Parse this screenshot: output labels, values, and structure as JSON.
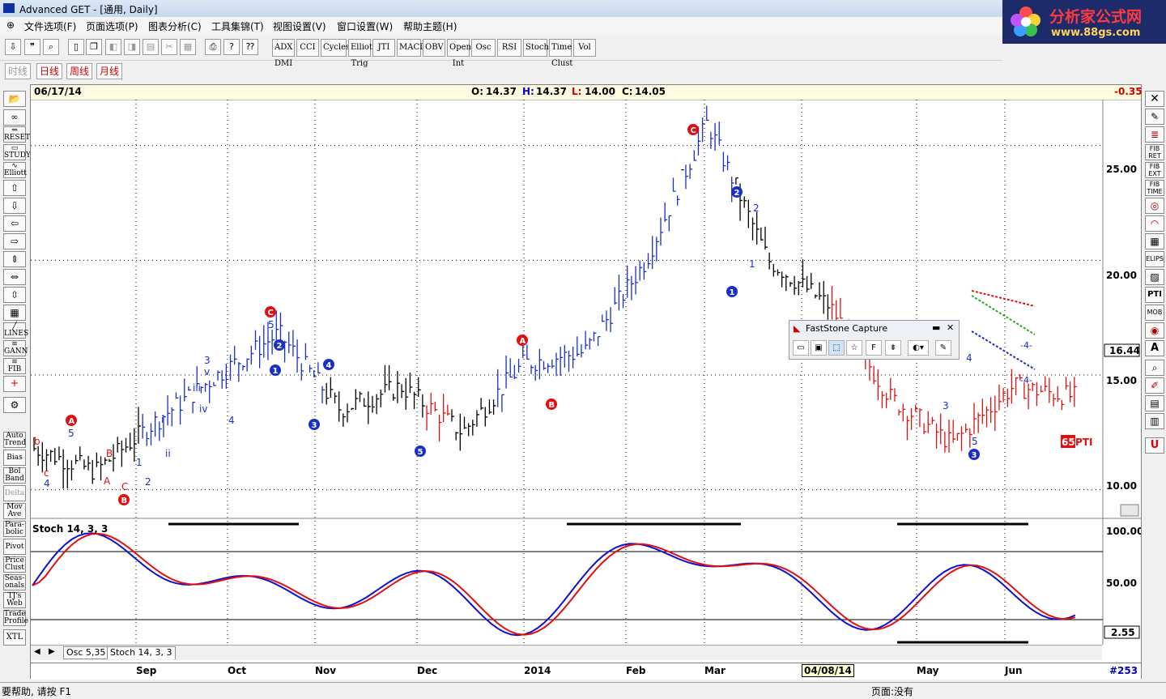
{
  "window": {
    "title": "Advanced GET - [通用, Daily]"
  },
  "brand": {
    "name": "分析家公式网",
    "url": "www.88gs.com"
  },
  "menu": [
    "文件选项(F)",
    "页面选项(P)",
    "图表分析(C)",
    "工具集锦(T)",
    "视图设置(V)",
    "窗口设置(W)",
    "帮助主题(H)"
  ],
  "toolbar": {
    "indicators": [
      "ADX DMI",
      "CCI",
      "Cycles",
      "Elliott Trig",
      "JTI",
      "MACD",
      "OBV",
      "Open Int",
      "Osc",
      "RSI",
      "Stoch",
      "Time Clust",
      "Vol"
    ]
  },
  "periods": [
    "时线",
    "日线",
    "周线",
    "月线"
  ],
  "left_tools": [
    "RESET",
    "STUDY",
    "Elliott",
    "LINES",
    "GANN",
    "FIB",
    "Auto Trend",
    "Bias",
    "Bol Band",
    "Delta",
    "Mov Ave",
    "Para-bolic",
    "Pivot",
    "Price Clust",
    "Seas-onals",
    "TJ's Web",
    "Trade Profile",
    "XTL"
  ],
  "right_tools": [
    "FIB RET",
    "FIB EXT",
    "FIB TIME",
    "ELIPS",
    "PTI",
    "MOB",
    "A"
  ],
  "info": {
    "date": "06/17/14",
    "o_label": "O:",
    "o": "14.37",
    "h_label": "H:",
    "h": "14.37",
    "l_label": "L:",
    "l": "14.00",
    "c_label": "C:",
    "c": "14.05",
    "change": "-0.35"
  },
  "price_axis": {
    "ticks": [
      "25.00",
      "20.00",
      "15.00",
      "10.00"
    ],
    "current_price": "16.44",
    "pti": "65",
    "pti_label": "PTI"
  },
  "osc": {
    "title": "Stoch 14, 3, 3",
    "ticks": [
      "100.00",
      "50.00"
    ],
    "current": "2.55"
  },
  "tabs": [
    "Osc 5,35",
    "Stoch 14, 3, 3"
  ],
  "x_axis": {
    "months": [
      "Sep",
      "Oct",
      "Nov",
      "Dec",
      "2014",
      "Feb",
      "Mar",
      "May",
      "Jun"
    ],
    "cursor_date": "04/08/14",
    "bar_count": "#253"
  },
  "fastcapture": {
    "title": "FastStone Capture"
  },
  "status": {
    "help": "要帮助, 请按 F1",
    "page": "页面:没有"
  },
  "colors": {
    "up_wave": "#1a2fc8",
    "neutral": "#000000",
    "down_wave": "#e01010",
    "stoch_k": "#1010d0",
    "stoch_d": "#e01010"
  },
  "chart_data": {
    "type": "bar",
    "title": "",
    "ylim": [
      9,
      27
    ],
    "price_close_approx": [
      {
        "x": "Aug",
        "y": 11.8
      },
      {
        "x": "Sep",
        "y": 10.8
      },
      {
        "x": "Sep-mid",
        "y": 13.0
      },
      {
        "x": "Oct",
        "y": 15.0
      },
      {
        "x": "Oct-mid",
        "y": 16.8
      },
      {
        "x": "Nov",
        "y": 13.5
      },
      {
        "x": "Nov-mid",
        "y": 14.5
      },
      {
        "x": "Dec",
        "y": 12.5
      },
      {
        "x": "2014",
        "y": 15.5
      },
      {
        "x": "2014-mid",
        "y": 16.0
      },
      {
        "x": "Feb",
        "y": 20.0
      },
      {
        "x": "Feb-late",
        "y": 26.0
      },
      {
        "x": "Mar",
        "y": 20.0
      },
      {
        "x": "Apr",
        "y": 18.0
      },
      {
        "x": "May",
        "y": 14.0
      },
      {
        "x": "May-mid",
        "y": 12.0
      },
      {
        "x": "Jun",
        "y": 14.5
      },
      {
        "x": "06/17/14",
        "y": 14.05
      }
    ],
    "wave_labels": [
      "A",
      "B",
      "C",
      "1",
      "2",
      "3",
      "4",
      "5"
    ],
    "stochastic": {
      "k": 14,
      "d": 3,
      "slowing": 3,
      "levels": [
        100,
        50
      ]
    }
  }
}
